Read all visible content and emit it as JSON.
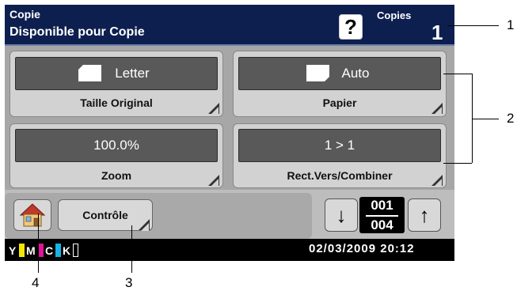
{
  "header": {
    "mode": "Copie",
    "status": "Disponible pour Copie",
    "help_symbol": "?",
    "copies_label": "Copies",
    "copies_value": "1"
  },
  "tiles": {
    "original_size": {
      "value": "Letter",
      "label": "Taille Original"
    },
    "paper": {
      "value": "Auto",
      "label": "Papier"
    },
    "zoom": {
      "value": "100.0%",
      "label": "Zoom"
    },
    "duplex": {
      "value": "1 > 1",
      "label": "Rect.Vers/Combiner"
    }
  },
  "bottom": {
    "controle_label": "Contrôle",
    "down_arrow": "↓",
    "up_arrow": "↑",
    "page_current": "001",
    "page_total": "004"
  },
  "status": {
    "toners": [
      {
        "letter": "Y",
        "color": "#f5e600"
      },
      {
        "letter": "M",
        "color": "#e0139a"
      },
      {
        "letter": "C",
        "color": "#16b3e8"
      },
      {
        "letter": "K",
        "color": "#000000"
      }
    ],
    "datetime": "02/03/2009  20:12"
  },
  "callouts": {
    "c1": "1",
    "c2": "2",
    "c3": "3",
    "c4": "4"
  }
}
